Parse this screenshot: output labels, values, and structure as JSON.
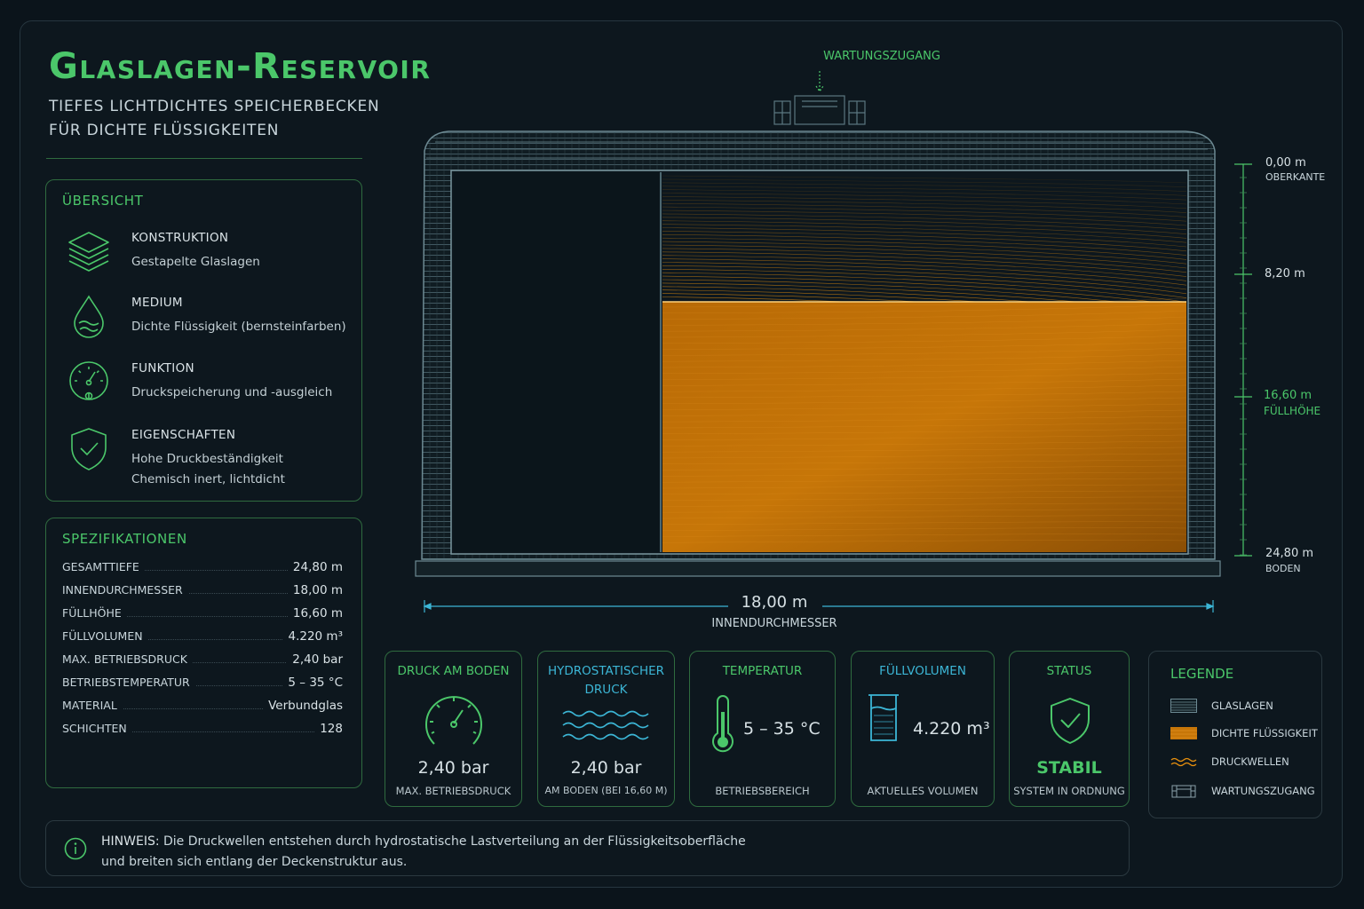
{
  "header": {
    "title": "Glaslagen-Reservoir",
    "subtitle_line1": "TIEFES LICHTDICHTES SPEICHERBECKEN",
    "subtitle_line2": "FÜR DICHTE FLÜSSIGKEITEN"
  },
  "overview": {
    "heading": "ÜBERSICHT",
    "items": [
      {
        "label": "KONSTRUKTION",
        "value": "Gestapelte Glaslagen",
        "icon": "stacked-layers-icon"
      },
      {
        "label": "MEDIUM",
        "value": "Dichte Flüssigkeit (bernsteinfarben)",
        "icon": "droplet-icon"
      },
      {
        "label": "FUNKTION",
        "value": "Druckspeicherung und -ausgleich",
        "icon": "gauge-icon"
      },
      {
        "label": "EIGENSCHAFTEN",
        "value": "Hohe Druckbeständigkeit",
        "value2": "Chemisch inert, lichtdicht",
        "icon": "shield-check-icon"
      }
    ]
  },
  "specs": {
    "heading": "SPEZIFIKATIONEN",
    "rows": [
      {
        "key": "GESAMTTIEFE",
        "value": "24,80 m"
      },
      {
        "key": "INNENDURCHMESSER",
        "value": "18,00 m"
      },
      {
        "key": "FÜLLHÖHE",
        "value": "16,60 m"
      },
      {
        "key": "FÜLLVOLUMEN",
        "value": "4.220 m³"
      },
      {
        "key": "MAX. BETRIEBSDRUCK",
        "value": "2,40 bar"
      },
      {
        "key": "BETRIEBSTEMPERATUR",
        "value": "5 – 35 °C"
      },
      {
        "key": "MATERIAL",
        "value": "Verbundglas"
      },
      {
        "key": "SCHICHTEN",
        "value": "128"
      }
    ]
  },
  "diagram": {
    "access_label": "WARTUNGSZUGANG",
    "scale": [
      {
        "value": "0,00 m",
        "caption": "OBERKANTE",
        "depth_m": 0
      },
      {
        "value": "8,20 m",
        "caption": "",
        "depth_m": 8.2
      },
      {
        "value": "16,60 m",
        "caption": "FÜLLHÖHE",
        "depth_m": 16.6,
        "highlight": true
      },
      {
        "value": "24,80 m",
        "caption": "BODEN",
        "depth_m": 24.8
      }
    ],
    "width_value": "18,00 m",
    "width_caption": "INNENDURCHMESSER",
    "colors": {
      "amber": "#e8900e",
      "glass": "#5b7780",
      "accent": "#4bc76a",
      "cyan": "#3cb6d6"
    }
  },
  "cards": [
    {
      "title": "DRUCK AM BODEN",
      "value": "2,40 bar",
      "sub": "MAX. BETRIEBSDRUCK",
      "icon": "gauge-icon"
    },
    {
      "title_line1": "HYDROSTATISCHER",
      "title_line2": "DRUCK",
      "value": "2,40 bar",
      "sub": "AM BODEN (BEI 16,60 m)",
      "icon": "waves-icon"
    },
    {
      "title": "TEMPERATUR",
      "value": "5 – 35 °C",
      "sub": "BETRIEBSBEREICH",
      "icon": "thermometer-icon"
    },
    {
      "title": "FÜLLVOLUMEN",
      "value": "4.220 m³",
      "sub": "AKTUELLES VOLUMEN",
      "icon": "beaker-icon"
    },
    {
      "title": "STATUS",
      "value": "STABIL",
      "sub": "SYSTEM IN ORDNUNG",
      "icon": "shield-check-icon"
    }
  ],
  "legend": {
    "heading": "LEGENDE",
    "items": [
      {
        "label": "GLASLAGEN",
        "icon": "glass-layers-swatch"
      },
      {
        "label": "DICHTE FLÜSSIGKEIT",
        "icon": "amber-liquid-swatch"
      },
      {
        "label": "DRUCKWELLEN",
        "icon": "pressure-wave-swatch"
      },
      {
        "label": "WARTUNGSZUGANG",
        "icon": "access-hatch-swatch"
      }
    ]
  },
  "hint": {
    "label": "HINWEIS:",
    "text1": "Die Druckwellen entstehen durch hydrostatische Lastverteilung an der Flüssigkeitsoberfläche",
    "text2": "und breiten sich entlang der Deckenstruktur aus."
  }
}
